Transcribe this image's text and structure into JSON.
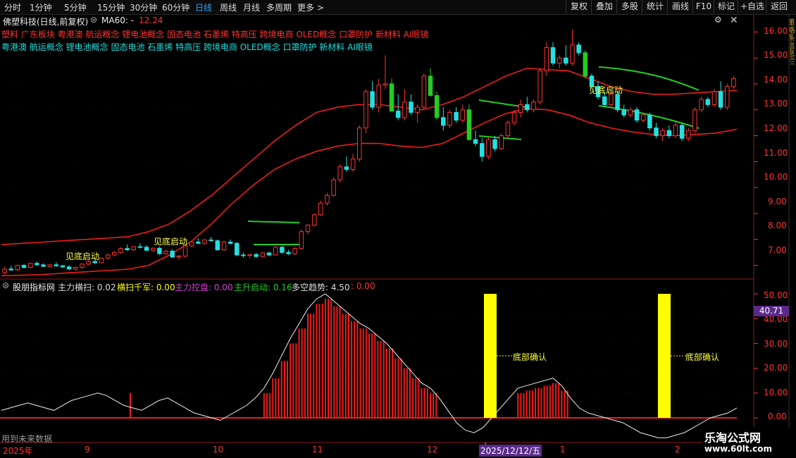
{
  "periods": [
    "分时",
    "1分钟",
    "5分钟",
    "15分钟",
    "30分钟",
    "60分钟",
    "日线",
    "周线",
    "月线",
    "多周期",
    "更多 >"
  ],
  "active_period": "日线",
  "toolbar_right": [
    "复权",
    "叠加",
    "多股",
    "统计",
    "画线",
    "F10",
    "标记",
    "+自选",
    "返回"
  ],
  "title": "佛塑科技(日线,前复权)",
  "ma_label": "MA60: -",
  "ma_value": "12.24",
  "concepts_row1": "塑料 广东板块 粤港澳 航运概念 锂电池概念 固态电池 石墨烯 特高压 跨境电商 OLED概念 口罩防护 新材料 AI眼镜",
  "concepts_row2": "粤港澳 航运概念 锂电池概念 固态电池 石墨烯 特高压 跨境电商 OLED概念 口罩防护 新材料 AI眼镜",
  "price_axis": [
    "16.00",
    "15.00",
    "14.00",
    "13.00",
    "12.00",
    "11.00",
    "10.00",
    "9.00",
    "8.00",
    "7.00"
  ],
  "signal_labels": [
    "见底启动",
    "见底启动",
    "见底启动"
  ],
  "indicator": {
    "name": "股朋指标网",
    "items": [
      {
        "label": "主力横扫: 0.02",
        "color": "#dddddd"
      },
      {
        "label": "横扫千军: 0.00",
        "color": "#ffff00"
      },
      {
        "label": "主力控盘: 0.00",
        "color": "#d040d0"
      },
      {
        "label": "主升启动: 0.16",
        "color": "#22cc22"
      },
      {
        "label": "多空趋势: 4.50",
        "color": "#dddddd"
      },
      {
        "label": ": 0.00",
        "color": "#ff3333"
      }
    ],
    "axis": [
      "50.00",
      "40.00",
      "30.00",
      "20.00",
      "10.00",
      "0.00"
    ],
    "current_value": "40.71",
    "confirm_label": "底部确认"
  },
  "future_data_note": "用到未来数据",
  "date_axis": {
    "year": "2025年",
    "months": [
      "9",
      "10",
      "11",
      "12",
      "1",
      "2"
    ],
    "cursor_date": "2025/12/12/五"
  },
  "side_strip_text": "策略条信息栏",
  "watermark": {
    "line1": "乐淘公式网",
    "line2": "www.60lt.com"
  },
  "colors": {
    "up": "#ff3333",
    "down": "#22e0e0",
    "green": "#22cc22",
    "yellow": "#ffff00",
    "bg": "#000000"
  },
  "chart_data": {
    "type": "candlestick",
    "ylim": [
      6.5,
      16.5
    ],
    "candles": [
      [
        6.72,
        6.95,
        6.65,
        6.85
      ],
      [
        6.86,
        6.98,
        6.8,
        6.82
      ],
      [
        6.83,
        7.02,
        6.78,
        7.0
      ],
      [
        7.0,
        7.05,
        6.88,
        6.92
      ],
      [
        6.92,
        7.1,
        6.9,
        7.08
      ],
      [
        7.08,
        7.15,
        6.98,
        7.02
      ],
      [
        7.02,
        7.08,
        6.94,
        6.96
      ],
      [
        6.96,
        7.05,
        6.9,
        7.02
      ],
      [
        7.02,
        7.12,
        6.95,
        6.98
      ],
      [
        6.98,
        7.02,
        6.9,
        6.94
      ],
      [
        6.94,
        7.0,
        6.82,
        6.86
      ],
      [
        6.86,
        6.95,
        6.78,
        6.92
      ],
      [
        6.92,
        7.08,
        6.88,
        7.05
      ],
      [
        7.05,
        7.2,
        7.0,
        7.15
      ],
      [
        7.15,
        7.25,
        7.05,
        7.1
      ],
      [
        7.1,
        7.3,
        7.08,
        7.28
      ],
      [
        7.28,
        7.45,
        7.22,
        7.4
      ],
      [
        7.4,
        7.55,
        7.35,
        7.5
      ],
      [
        7.5,
        7.7,
        7.45,
        7.65
      ],
      [
        7.65,
        7.8,
        7.55,
        7.6
      ],
      [
        7.6,
        7.75,
        7.55,
        7.72
      ],
      [
        7.72,
        7.85,
        7.65,
        7.7
      ],
      [
        7.7,
        7.78,
        7.55,
        7.58
      ],
      [
        7.58,
        7.7,
        7.52,
        7.66
      ],
      [
        7.66,
        7.72,
        7.4,
        7.45
      ],
      [
        7.45,
        7.6,
        7.4,
        7.55
      ],
      [
        7.55,
        7.62,
        7.28,
        7.32
      ],
      [
        7.32,
        7.4,
        7.22,
        7.36
      ],
      [
        7.36,
        7.8,
        7.3,
        7.75
      ],
      [
        7.75,
        7.95,
        7.7,
        7.9
      ],
      [
        7.9,
        8.05,
        7.82,
        7.85
      ],
      [
        7.85,
        8.0,
        7.8,
        7.98
      ],
      [
        7.98,
        8.1,
        7.92,
        7.95
      ],
      [
        7.95,
        8.0,
        7.55,
        7.6
      ],
      [
        7.6,
        7.95,
        7.55,
        7.9
      ],
      [
        7.9,
        8.0,
        7.8,
        7.85
      ],
      [
        7.85,
        7.9,
        7.35,
        7.4
      ],
      [
        7.4,
        7.5,
        7.3,
        7.38
      ],
      [
        7.38,
        7.45,
        7.28,
        7.42
      ],
      [
        7.42,
        7.48,
        7.3,
        7.34
      ],
      [
        7.34,
        7.5,
        7.3,
        7.48
      ],
      [
        7.48,
        7.52,
        7.35,
        7.4
      ],
      [
        7.4,
        7.75,
        7.38,
        7.7
      ],
      [
        7.7,
        7.75,
        7.45,
        7.5
      ],
      [
        7.5,
        7.6,
        7.4,
        7.45
      ],
      [
        7.45,
        7.7,
        7.4,
        7.65
      ],
      [
        7.65,
        8.4,
        7.6,
        8.3
      ],
      [
        8.3,
        8.6,
        8.2,
        8.55
      ],
      [
        8.55,
        9.0,
        8.5,
        8.95
      ],
      [
        8.95,
        9.5,
        8.9,
        9.4
      ],
      [
        9.4,
        9.8,
        9.3,
        9.7
      ],
      [
        9.7,
        10.4,
        9.65,
        10.3
      ],
      [
        10.3,
        10.9,
        10.2,
        10.8
      ],
      [
        10.8,
        11.2,
        10.6,
        10.7
      ],
      [
        10.7,
        11.3,
        10.6,
        11.1
      ],
      [
        11.1,
        12.4,
        11.0,
        12.3
      ],
      [
        12.3,
        13.8,
        12.1,
        13.7
      ],
      [
        13.7,
        14.1,
        13.0,
        13.1
      ],
      [
        13.1,
        14.2,
        12.9,
        13.95
      ],
      [
        13.95,
        15.1,
        13.8,
        14.0
      ],
      [
        14.0,
        14.2,
        12.9,
        12.95
      ],
      [
        12.95,
        13.6,
        12.6,
        12.7
      ],
      [
        12.7,
        13.8,
        12.6,
        13.3
      ],
      [
        13.3,
        13.6,
        12.8,
        12.9
      ],
      [
        12.9,
        13.2,
        12.5,
        13.1
      ],
      [
        13.1,
        14.4,
        13.0,
        14.3
      ],
      [
        14.3,
        14.6,
        13.5,
        13.55
      ],
      [
        13.55,
        13.7,
        12.6,
        12.7
      ],
      [
        12.7,
        13.1,
        12.2,
        12.4
      ],
      [
        12.4,
        13.0,
        12.3,
        12.9
      ],
      [
        12.9,
        13.1,
        12.5,
        12.6
      ],
      [
        12.6,
        13.2,
        12.5,
        13.0
      ],
      [
        13.0,
        13.2,
        11.8,
        11.85
      ],
      [
        11.85,
        12.2,
        11.6,
        11.7
      ],
      [
        11.7,
        11.9,
        11.0,
        11.2
      ],
      [
        11.2,
        11.95,
        11.1,
        11.85
      ],
      [
        11.85,
        12.0,
        11.4,
        11.5
      ],
      [
        11.5,
        12.1,
        11.45,
        12.0
      ],
      [
        12.0,
        12.6,
        11.9,
        12.5
      ],
      [
        12.5,
        13.0,
        12.4,
        12.9
      ],
      [
        12.9,
        13.4,
        12.7,
        13.2
      ],
      [
        13.2,
        13.5,
        12.9,
        13.0
      ],
      [
        13.0,
        13.4,
        12.9,
        13.3
      ],
      [
        13.3,
        14.6,
        13.2,
        14.5
      ],
      [
        14.5,
        15.6,
        14.3,
        15.4
      ],
      [
        15.4,
        15.6,
        14.7,
        14.8
      ],
      [
        14.8,
        15.1,
        14.6,
        15.0
      ],
      [
        15.0,
        15.5,
        14.7,
        14.8
      ],
      [
        14.8,
        16.1,
        14.7,
        15.5
      ],
      [
        15.5,
        15.6,
        15.1,
        15.2
      ],
      [
        15.2,
        15.3,
        14.2,
        14.3
      ],
      [
        14.3,
        14.4,
        13.8,
        13.9
      ],
      [
        13.9,
        14.1,
        13.4,
        13.5
      ],
      [
        13.5,
        13.7,
        13.1,
        13.2
      ],
      [
        13.2,
        13.8,
        13.1,
        13.6
      ],
      [
        13.6,
        13.7,
        12.9,
        13.0
      ],
      [
        13.0,
        13.2,
        12.7,
        12.8
      ],
      [
        12.8,
        13.1,
        12.7,
        13.0
      ],
      [
        13.0,
        13.1,
        12.5,
        12.6
      ],
      [
        12.6,
        12.9,
        12.5,
        12.8
      ],
      [
        12.8,
        12.9,
        12.2,
        12.3
      ],
      [
        12.3,
        12.5,
        11.9,
        12.0
      ],
      [
        12.0,
        12.3,
        11.8,
        12.2
      ],
      [
        12.2,
        12.4,
        11.9,
        12.0
      ],
      [
        12.0,
        12.6,
        11.9,
        12.4
      ],
      [
        12.4,
        12.5,
        11.8,
        11.9
      ],
      [
        11.9,
        12.3,
        11.8,
        12.2
      ],
      [
        12.2,
        13.1,
        12.1,
        13.0
      ],
      [
        13.0,
        13.5,
        12.9,
        13.4
      ],
      [
        13.4,
        13.5,
        13.1,
        13.2
      ],
      [
        13.2,
        13.8,
        13.1,
        13.7
      ],
      [
        13.7,
        14.1,
        13.0,
        13.1
      ],
      [
        13.1,
        14.0,
        13.0,
        13.9
      ],
      [
        13.9,
        14.3,
        13.8,
        14.2
      ]
    ],
    "red_band_upper": [
      7.8,
      7.85,
      7.9,
      7.95,
      8.0,
      8.05,
      8.1,
      8.3,
      8.6,
      9.1,
      9.7,
      10.4,
      11.1,
      11.8,
      12.4,
      12.9,
      13.1,
      13.2,
      13.2,
      13.1,
      13.0,
      13.2,
      13.5,
      13.9,
      14.3,
      14.6,
      14.55,
      14.5,
      14.2,
      13.9,
      13.7,
      13.6,
      13.6,
      13.65,
      13.7,
      13.75
    ],
    "red_band_lower": [
      6.6,
      6.62,
      6.65,
      6.7,
      6.75,
      6.8,
      6.85,
      7.0,
      7.4,
      7.9,
      8.6,
      9.4,
      10.1,
      10.7,
      11.1,
      11.4,
      11.6,
      11.7,
      11.7,
      11.6,
      11.55,
      11.7,
      12.1,
      12.5,
      12.85,
      13.05,
      13.0,
      12.8,
      12.5,
      12.3,
      12.15,
      12.05,
      12.0,
      12.05,
      12.1,
      12.25
    ],
    "indicator_line": [
      3,
      4,
      5,
      6,
      5,
      4,
      3,
      5,
      7,
      8,
      9,
      10,
      9,
      7,
      5,
      4,
      3,
      5,
      7,
      8,
      6,
      4,
      2,
      1,
      0,
      -1,
      1,
      3,
      5,
      8,
      12,
      18,
      25,
      32,
      38,
      44,
      48,
      50,
      47,
      44,
      41,
      38,
      36,
      33,
      30,
      26,
      22,
      18,
      14,
      12,
      8,
      3,
      -2,
      -5,
      -6,
      -4,
      0,
      4,
      8,
      12,
      13,
      14,
      15,
      16,
      13,
      8,
      4,
      2,
      1,
      0,
      -1,
      -2,
      -4,
      -6,
      -7,
      -8,
      -8,
      -7,
      -6,
      -4,
      -2,
      0,
      1,
      2,
      4
    ],
    "confirm_bars": [
      {
        "x_index": 20,
        "value": 50
      },
      {
        "x_index": 27,
        "value": 50
      }
    ]
  }
}
